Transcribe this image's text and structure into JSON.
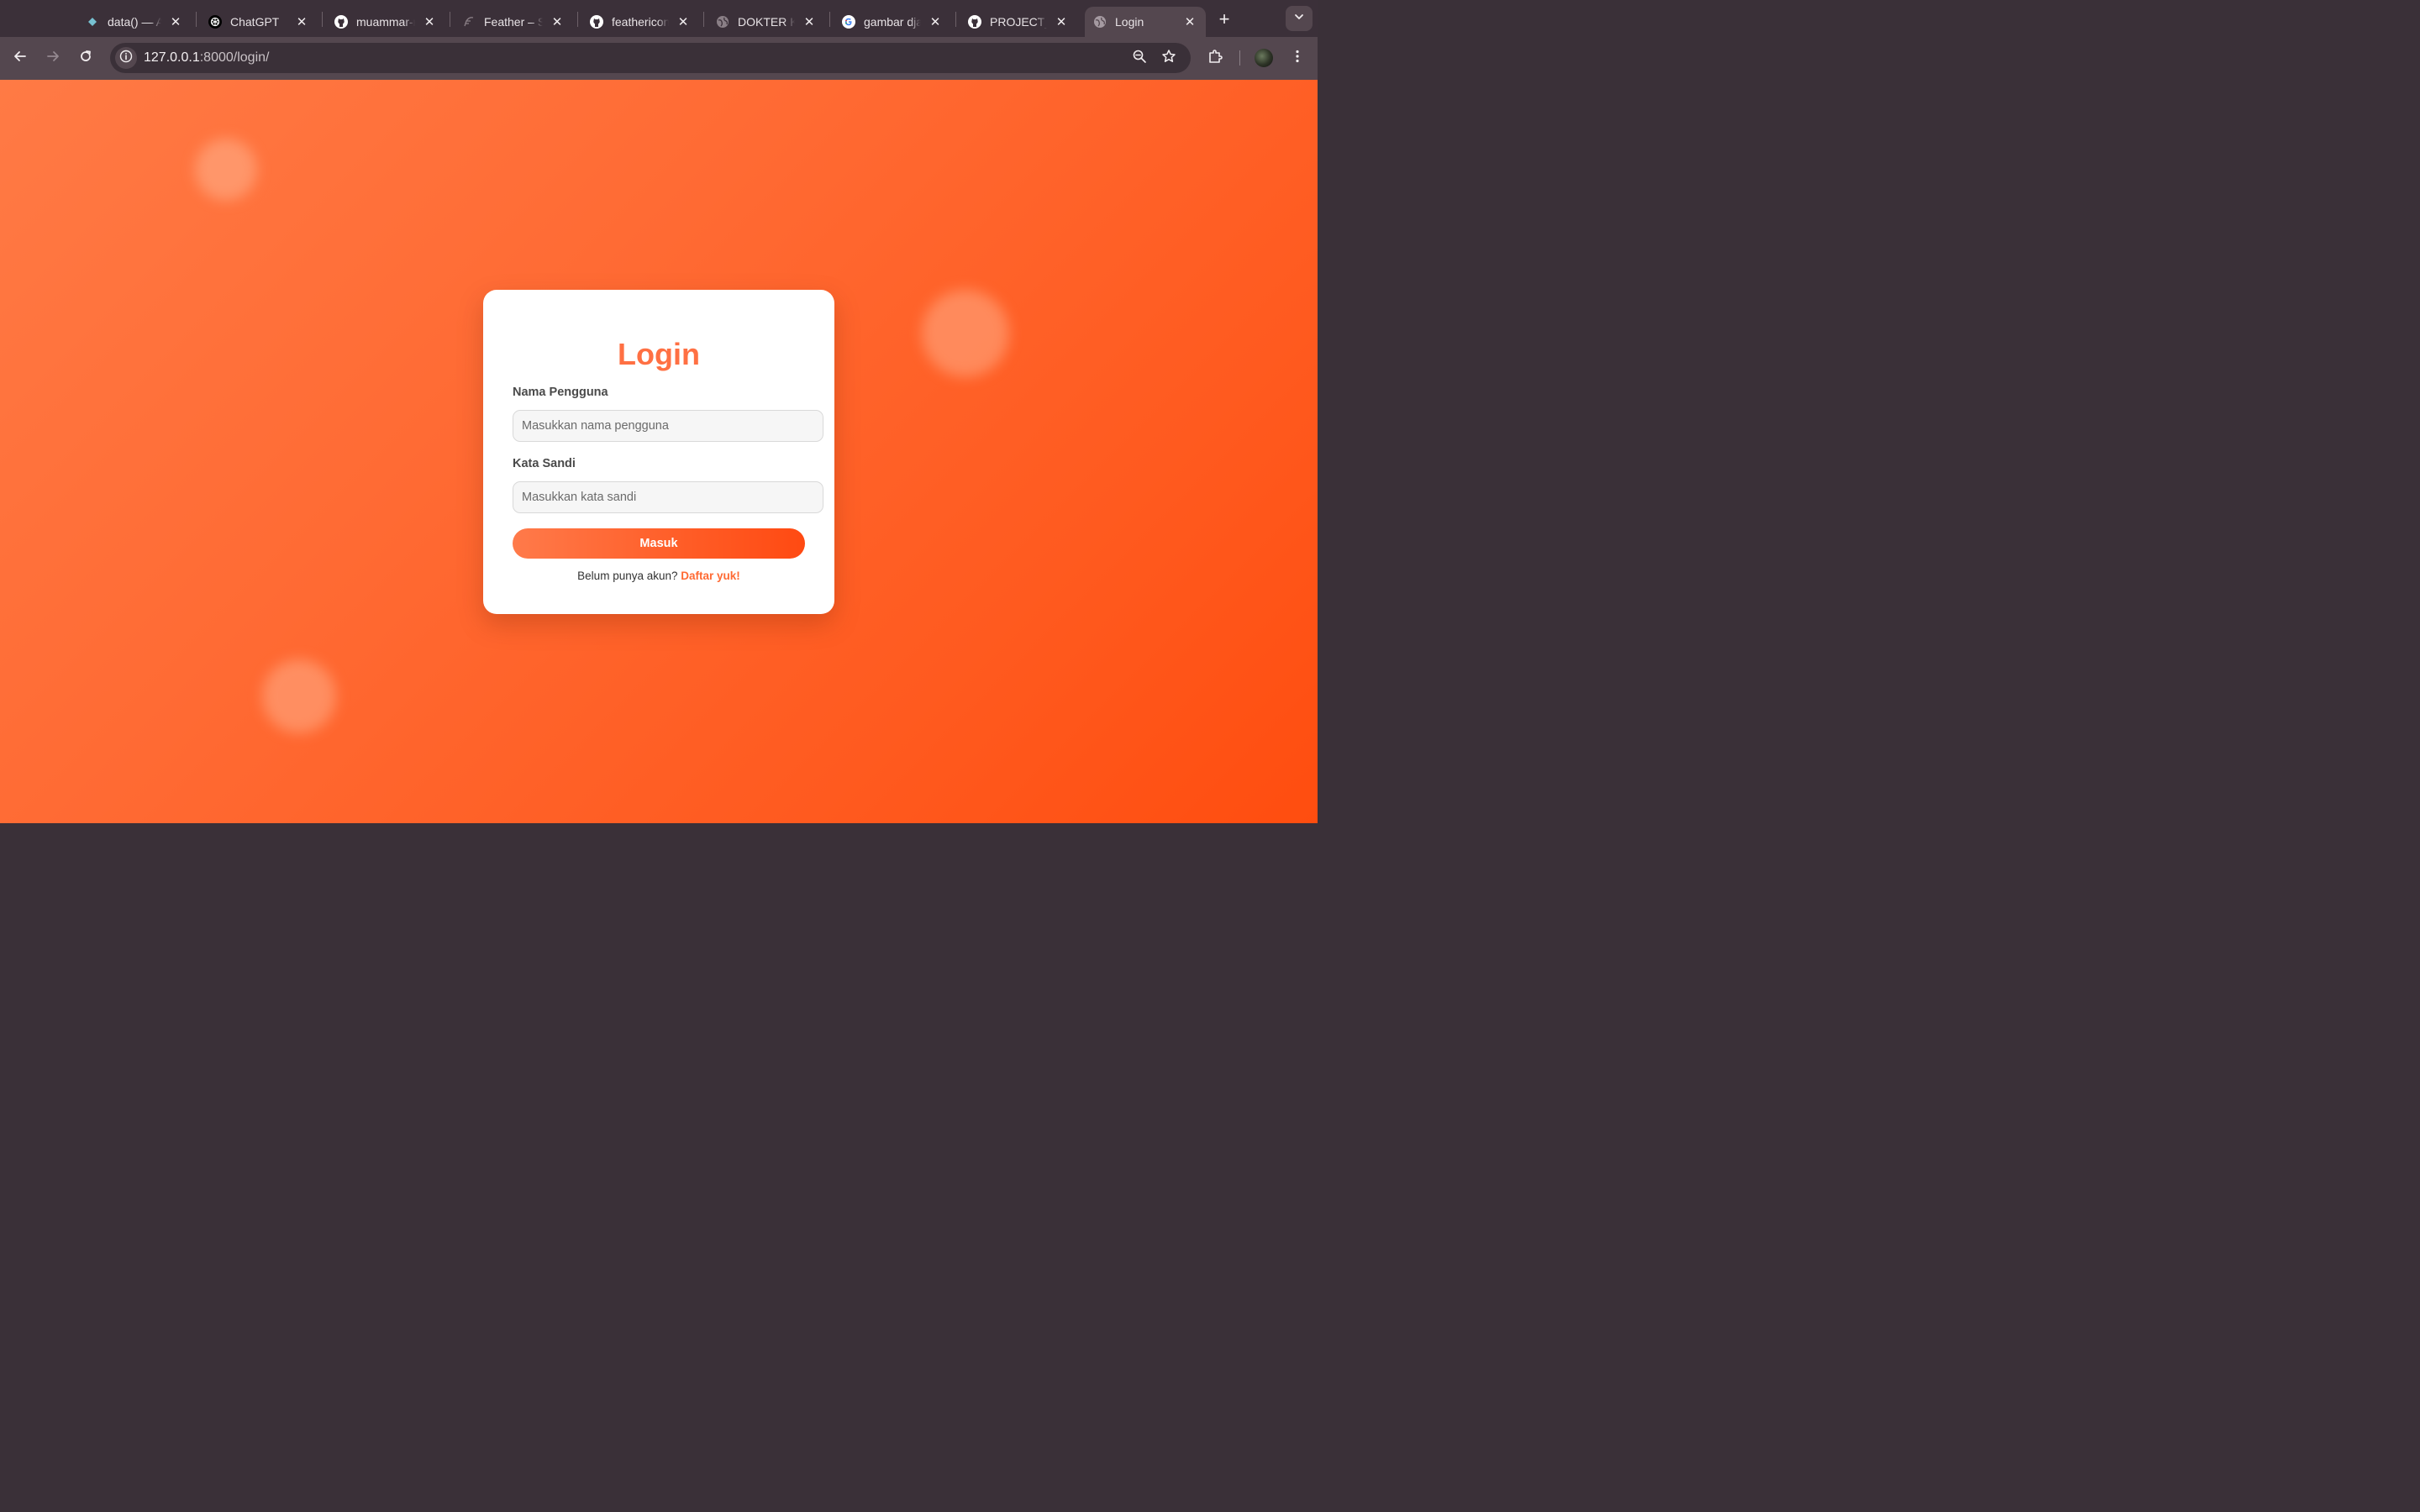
{
  "browser": {
    "tabs": [
      {
        "title": "data() — Alpine.js",
        "icon": "alpine-icon"
      },
      {
        "title": "ChatGPT",
        "icon": "chatgpt-icon"
      },
      {
        "title": "muammar-r",
        "icon": "github-icon"
      },
      {
        "title": "Feather – Si",
        "icon": "feather-icon"
      },
      {
        "title": "feathericons",
        "icon": "github-icon"
      },
      {
        "title": "DOKTER KO",
        "icon": "globe-icon"
      },
      {
        "title": "gambar djan",
        "icon": "google-icon"
      },
      {
        "title": "PROJECT_E",
        "icon": "github-icon"
      },
      {
        "title": "Login",
        "icon": "globe-icon",
        "active": true
      }
    ],
    "close_glyph": "✕",
    "new_tab_glyph": "+",
    "url_host": "127.0.0.1",
    "url_rest": ":8000/login/"
  },
  "login": {
    "title": "Login",
    "username_label": "Nama Pengguna",
    "username_placeholder": "Masukkan nama pengguna",
    "password_label": "Kata Sandi",
    "password_placeholder": "Masukkan kata sandi",
    "submit_label": "Masuk",
    "signup_prompt": "Belum punya akun?",
    "signup_link": "Daftar yuk!"
  },
  "colors": {
    "accent": "#ff7043",
    "background_start": "#ff7a45",
    "background_end": "#ff4d0f"
  }
}
